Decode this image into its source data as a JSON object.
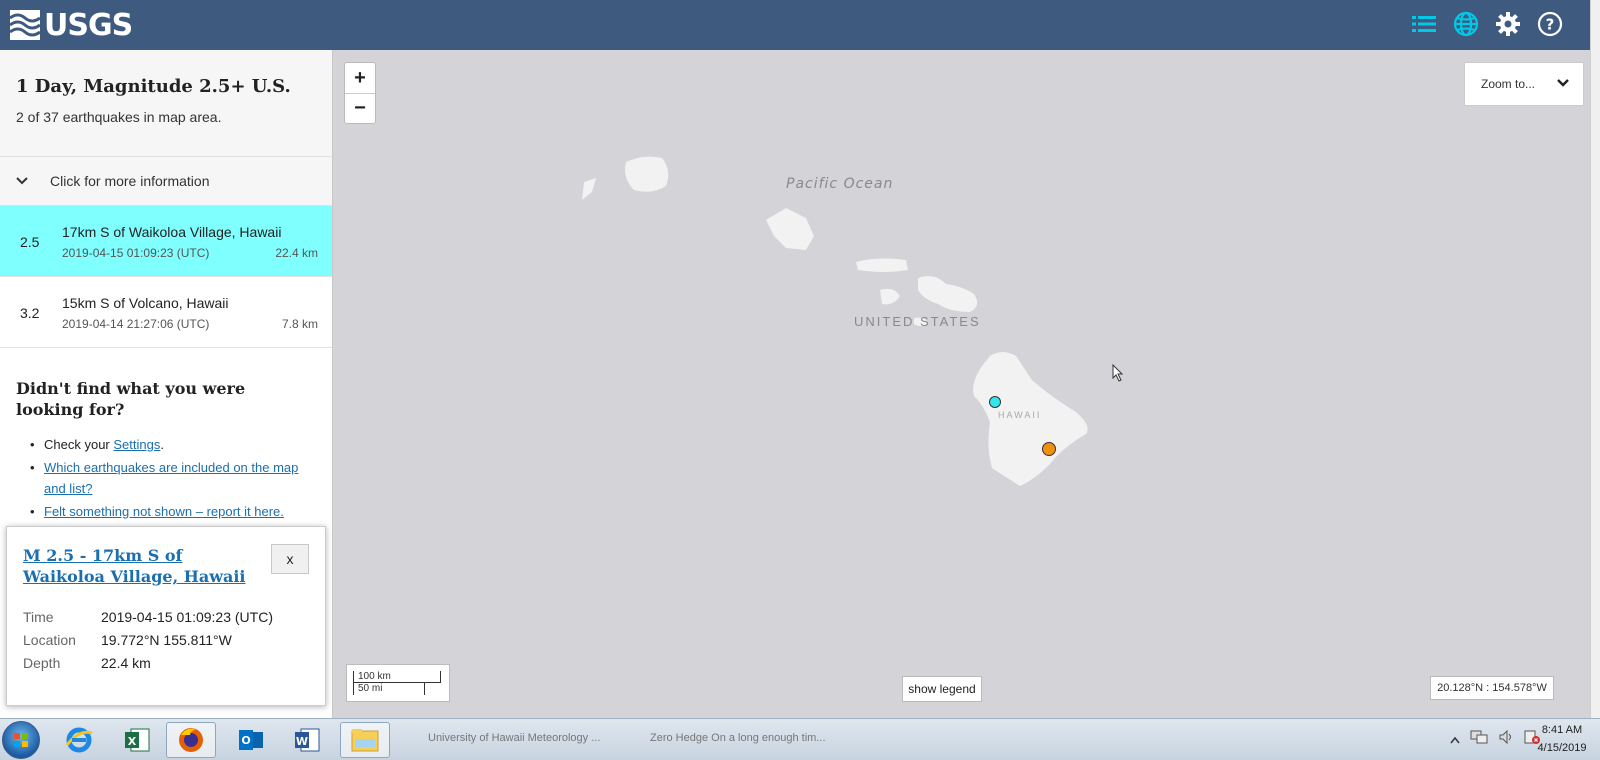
{
  "header": {
    "logo_text": "USGS",
    "icons": [
      "list-icon",
      "globe-icon",
      "gear-icon",
      "help-icon"
    ],
    "accent_color": "#00c8e6",
    "bg_color": "#3e5b7f"
  },
  "sidebar": {
    "title": "1 Day, Magnitude 2.5+ U.S.",
    "subtitle": "2 of 37 earthquakes in map area.",
    "more_info": "Click for more information",
    "earthquakes": [
      {
        "mag": "2.5",
        "place": "17km S of Waikoloa Village, Hawaii",
        "time": "2019-04-15 01:09:23 (UTC)",
        "depth": "22.4 km",
        "selected": true,
        "color": "#80ffff"
      },
      {
        "mag": "3.2",
        "place": "15km S of Volcano, Hawaii",
        "time": "2019-04-14 21:27:06 (UTC)",
        "depth": "7.8 km",
        "selected": false
      }
    ],
    "help": {
      "title": "Didn't find what you were looking for?",
      "check_prefix": "Check your ",
      "settings_link": "Settings",
      "check_suffix": ".",
      "link2": "Which earthquakes are included on the map and list?",
      "link3": "Felt something not shown – report it here."
    }
  },
  "popup": {
    "title": "M 2.5 - 17km S of Waikoloa Village, Hawaii",
    "close": "x",
    "rows": [
      {
        "label": "Time",
        "value": "2019-04-15 01:09:23 (UTC)"
      },
      {
        "label": "Location",
        "value": "19.772°N 155.811°W"
      },
      {
        "label": "Depth",
        "value": "22.4 km"
      }
    ]
  },
  "map": {
    "zoom_in": "+",
    "zoom_out": "−",
    "zoom_to": "Zoom to...",
    "ocean_label": "Pacific Ocean",
    "country_label": "UNITED STATES",
    "island_label": "HAWAII",
    "scale_km": "100 km",
    "scale_mi": "50 mi",
    "legend_button": "show legend",
    "coords": "20.128°N : 154.578°W",
    "marker_colors": {
      "selected": "#33e6ee",
      "other": "#f0900f"
    }
  },
  "taskbar": {
    "apps": [
      "start-orb",
      "internet-explorer-icon",
      "excel-icon",
      "firefox-icon",
      "outlook-icon",
      "word-icon",
      "file-explorer-icon"
    ],
    "bg_text_1": "University of Hawaii Meteorology ...",
    "bg_text_2": "Zero Hedge On a long enough tim...",
    "time": "8:41 AM",
    "date": "4/15/2019"
  }
}
